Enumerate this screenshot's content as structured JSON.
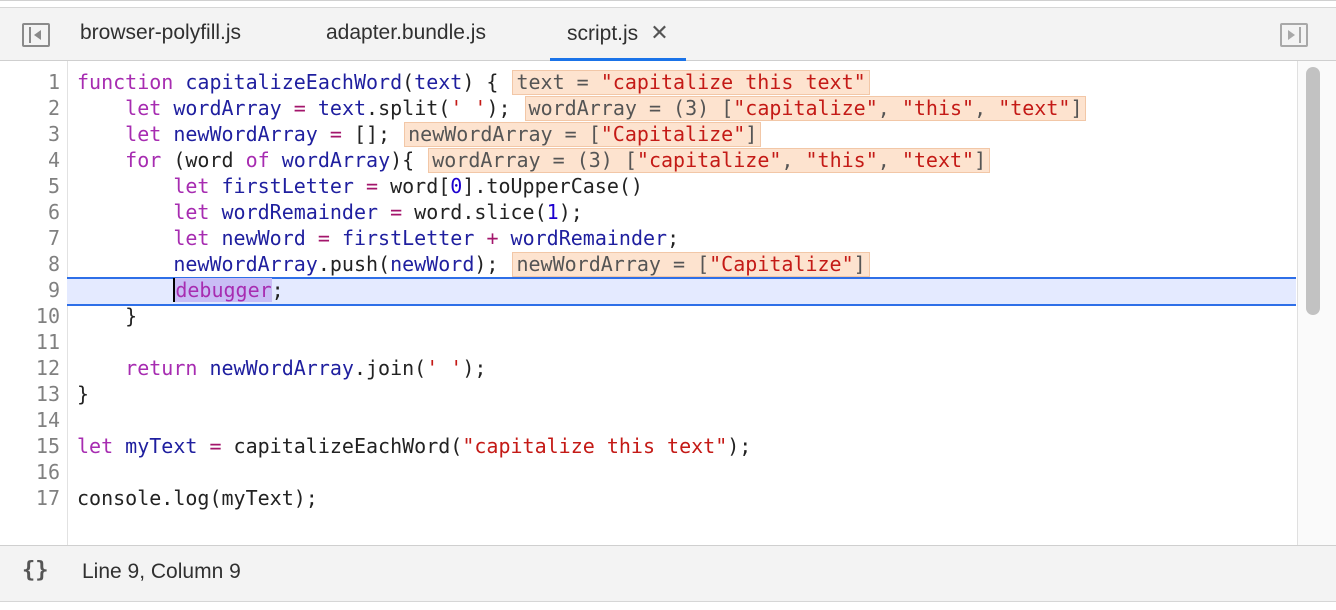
{
  "tabs": {
    "items": [
      {
        "label": "browser-polyfill.js"
      },
      {
        "label": "adapter.bundle.js"
      },
      {
        "label": "script.js"
      }
    ],
    "close_glyph": "✕"
  },
  "code": {
    "line_numbers": [
      "1",
      "2",
      "3",
      "4",
      "5",
      "6",
      "7",
      "8",
      "9",
      "10",
      "11",
      "12",
      "13",
      "14",
      "15",
      "16",
      "17"
    ],
    "inline_values": {
      "l1": {
        "name": "text = ",
        "value": "\"capitalize this text\""
      },
      "l2": {
        "name": "wordArray = (3) [",
        "v1": "\"capitalize\"",
        "sep1": ", ",
        "v2": "\"this\"",
        "sep2": ", ",
        "v3": "\"text\"",
        "end": "]"
      },
      "l3": {
        "name": "newWordArray = [",
        "v1": "\"Capitalize\"",
        "end": "]"
      },
      "l4": {
        "name": "wordArray = (3) [",
        "v1": "\"capitalize\"",
        "sep1": ", ",
        "v2": "\"this\"",
        "sep2": ", ",
        "v3": "\"text\"",
        "end": "]"
      },
      "l8": {
        "name": "newWordArray = [",
        "v1": "\"Capitalize\"",
        "end": "]"
      }
    }
  },
  "status": {
    "pretty_print_glyph": "{}",
    "position": "Line 9, Column 9"
  },
  "colors": {
    "accent": "#1a73e8",
    "current_line": "#e4eaff",
    "inline_value_bg": "#fde3cf"
  }
}
